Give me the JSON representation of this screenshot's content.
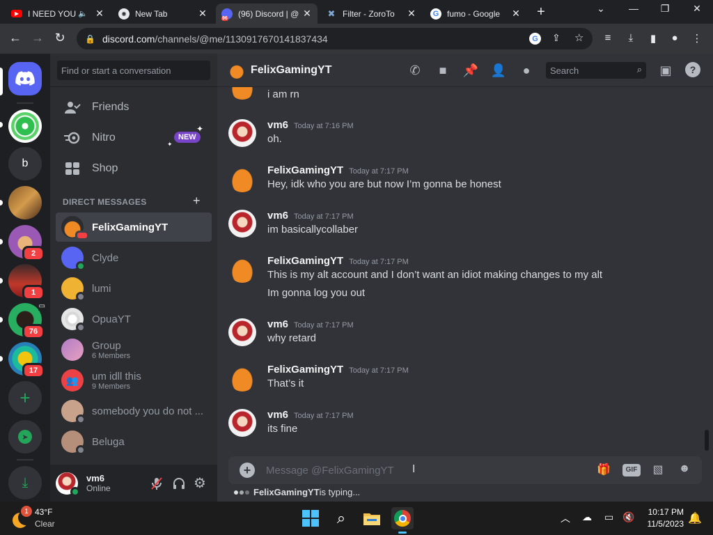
{
  "browser": {
    "tabs": [
      {
        "title": "I NEED YOU",
        "favicon": "youtube-icon",
        "color": "#ff0000"
      },
      {
        "title": "New Tab",
        "favicon": "chrome-icon",
        "color": "#e8eaed"
      },
      {
        "title": "(96) Discord | @",
        "favicon": "discord-icon",
        "badge": "96",
        "color": "#5865f2"
      },
      {
        "title": "Filter - ZoroTo",
        "favicon": "zoro-icon",
        "color": "#7fa8d6"
      },
      {
        "title": "fumo - Google",
        "favicon": "google-icon",
        "color": "#4285f4"
      }
    ],
    "url_host": "discord.com",
    "url_path": "/channels/@me/1130917670141837434"
  },
  "guilds": [
    {
      "name": "discord-home",
      "label": "",
      "color": "#5865f2"
    },
    {
      "name": "server-citrus",
      "label": "",
      "color": "#2fbf4f"
    },
    {
      "name": "server-b",
      "label": "b",
      "color": "#313338"
    },
    {
      "name": "server-4",
      "label": "",
      "color": "#8a5a2b"
    },
    {
      "name": "server-5",
      "label": "",
      "color": "#9b59b6",
      "badge": "2"
    },
    {
      "name": "server-6",
      "label": "",
      "color": "#c0392b",
      "badge": "1"
    },
    {
      "name": "server-7",
      "label": "",
      "color": "#27ae60",
      "badge": "76"
    },
    {
      "name": "server-8",
      "label": "",
      "color": "#1abc9c",
      "badge": "17"
    }
  ],
  "sidebar": {
    "search_placeholder": "Find or start a conversation",
    "nav": [
      {
        "label": "Friends",
        "icon": "friends-icon"
      },
      {
        "label": "Nitro",
        "icon": "nitro-icon",
        "badge": "NEW"
      },
      {
        "label": "Shop",
        "icon": "shop-icon"
      }
    ],
    "dm_header": "DIRECT MESSAGES",
    "dms": [
      {
        "name": "FelixGamingYT",
        "selected": true,
        "avatar_color": "#f08a24"
      },
      {
        "name": "Clyde",
        "avatar_color": "#5865f2",
        "status_color": "#23a55a"
      },
      {
        "name": "lumi",
        "avatar_color": "#f0b232",
        "status_color": "#80848e"
      },
      {
        "name": "OpuaYT",
        "avatar_color": "#e6e6e6",
        "status_color": "#80848e"
      },
      {
        "name": "Group",
        "sub": "6 Members",
        "avatar_color": "#b07cc6"
      },
      {
        "name": "um idll this",
        "sub": "9 Members",
        "avatar_color": "#ed4245"
      },
      {
        "name": "somebody you do not ...",
        "avatar_color": "#c9a28c",
        "status_color": "#80848e"
      },
      {
        "name": "Beluga",
        "avatar_color": "#b58f7a",
        "status_color": "#80848e"
      }
    ],
    "user": {
      "name": "vm6",
      "status": "Online"
    }
  },
  "chat": {
    "recipient": "FelixGamingYT",
    "search_placeholder": "Search",
    "messages": [
      {
        "author": "",
        "time": "",
        "lines": [
          "i am rn"
        ],
        "avatar": "pumpkin"
      },
      {
        "author": "vm6",
        "time": "Today at 7:16 PM",
        "lines": [
          "oh."
        ],
        "avatar": "reimu"
      },
      {
        "author": "FelixGamingYT",
        "time": "Today at 7:17 PM",
        "lines": [
          "Hey, idk who you are but now I’m gonna be honest"
        ],
        "avatar": "pumpkin"
      },
      {
        "author": "vm6",
        "time": "Today at 7:17 PM",
        "lines": [
          "im basicallycollaber"
        ],
        "avatar": "reimu"
      },
      {
        "author": "FelixGamingYT",
        "time": "Today at 7:17 PM",
        "lines": [
          "This is my alt account and I don’t want an idiot making changes to my alt",
          "Im gonna log you out"
        ],
        "avatar": "pumpkin"
      },
      {
        "author": "vm6",
        "time": "Today at 7:17 PM",
        "lines": [
          "why retard"
        ],
        "avatar": "reimu"
      },
      {
        "author": "FelixGamingYT",
        "time": "Today at 7:17 PM",
        "lines": [
          "That’s it"
        ],
        "avatar": "pumpkin"
      },
      {
        "author": "vm6",
        "time": "Today at 7:17 PM",
        "lines": [
          "its fine"
        ],
        "avatar": "reimu"
      }
    ],
    "composer_placeholder": "Message @FelixGamingYT",
    "typing_user": "FelixGamingYT",
    "typing_suffix": " is typing..."
  },
  "taskbar": {
    "weather_badge": "1",
    "temperature": "43°F",
    "weather": "Clear",
    "time": "10:17 PM",
    "date": "11/5/2023"
  },
  "labels": {
    "gif": "GIF"
  }
}
